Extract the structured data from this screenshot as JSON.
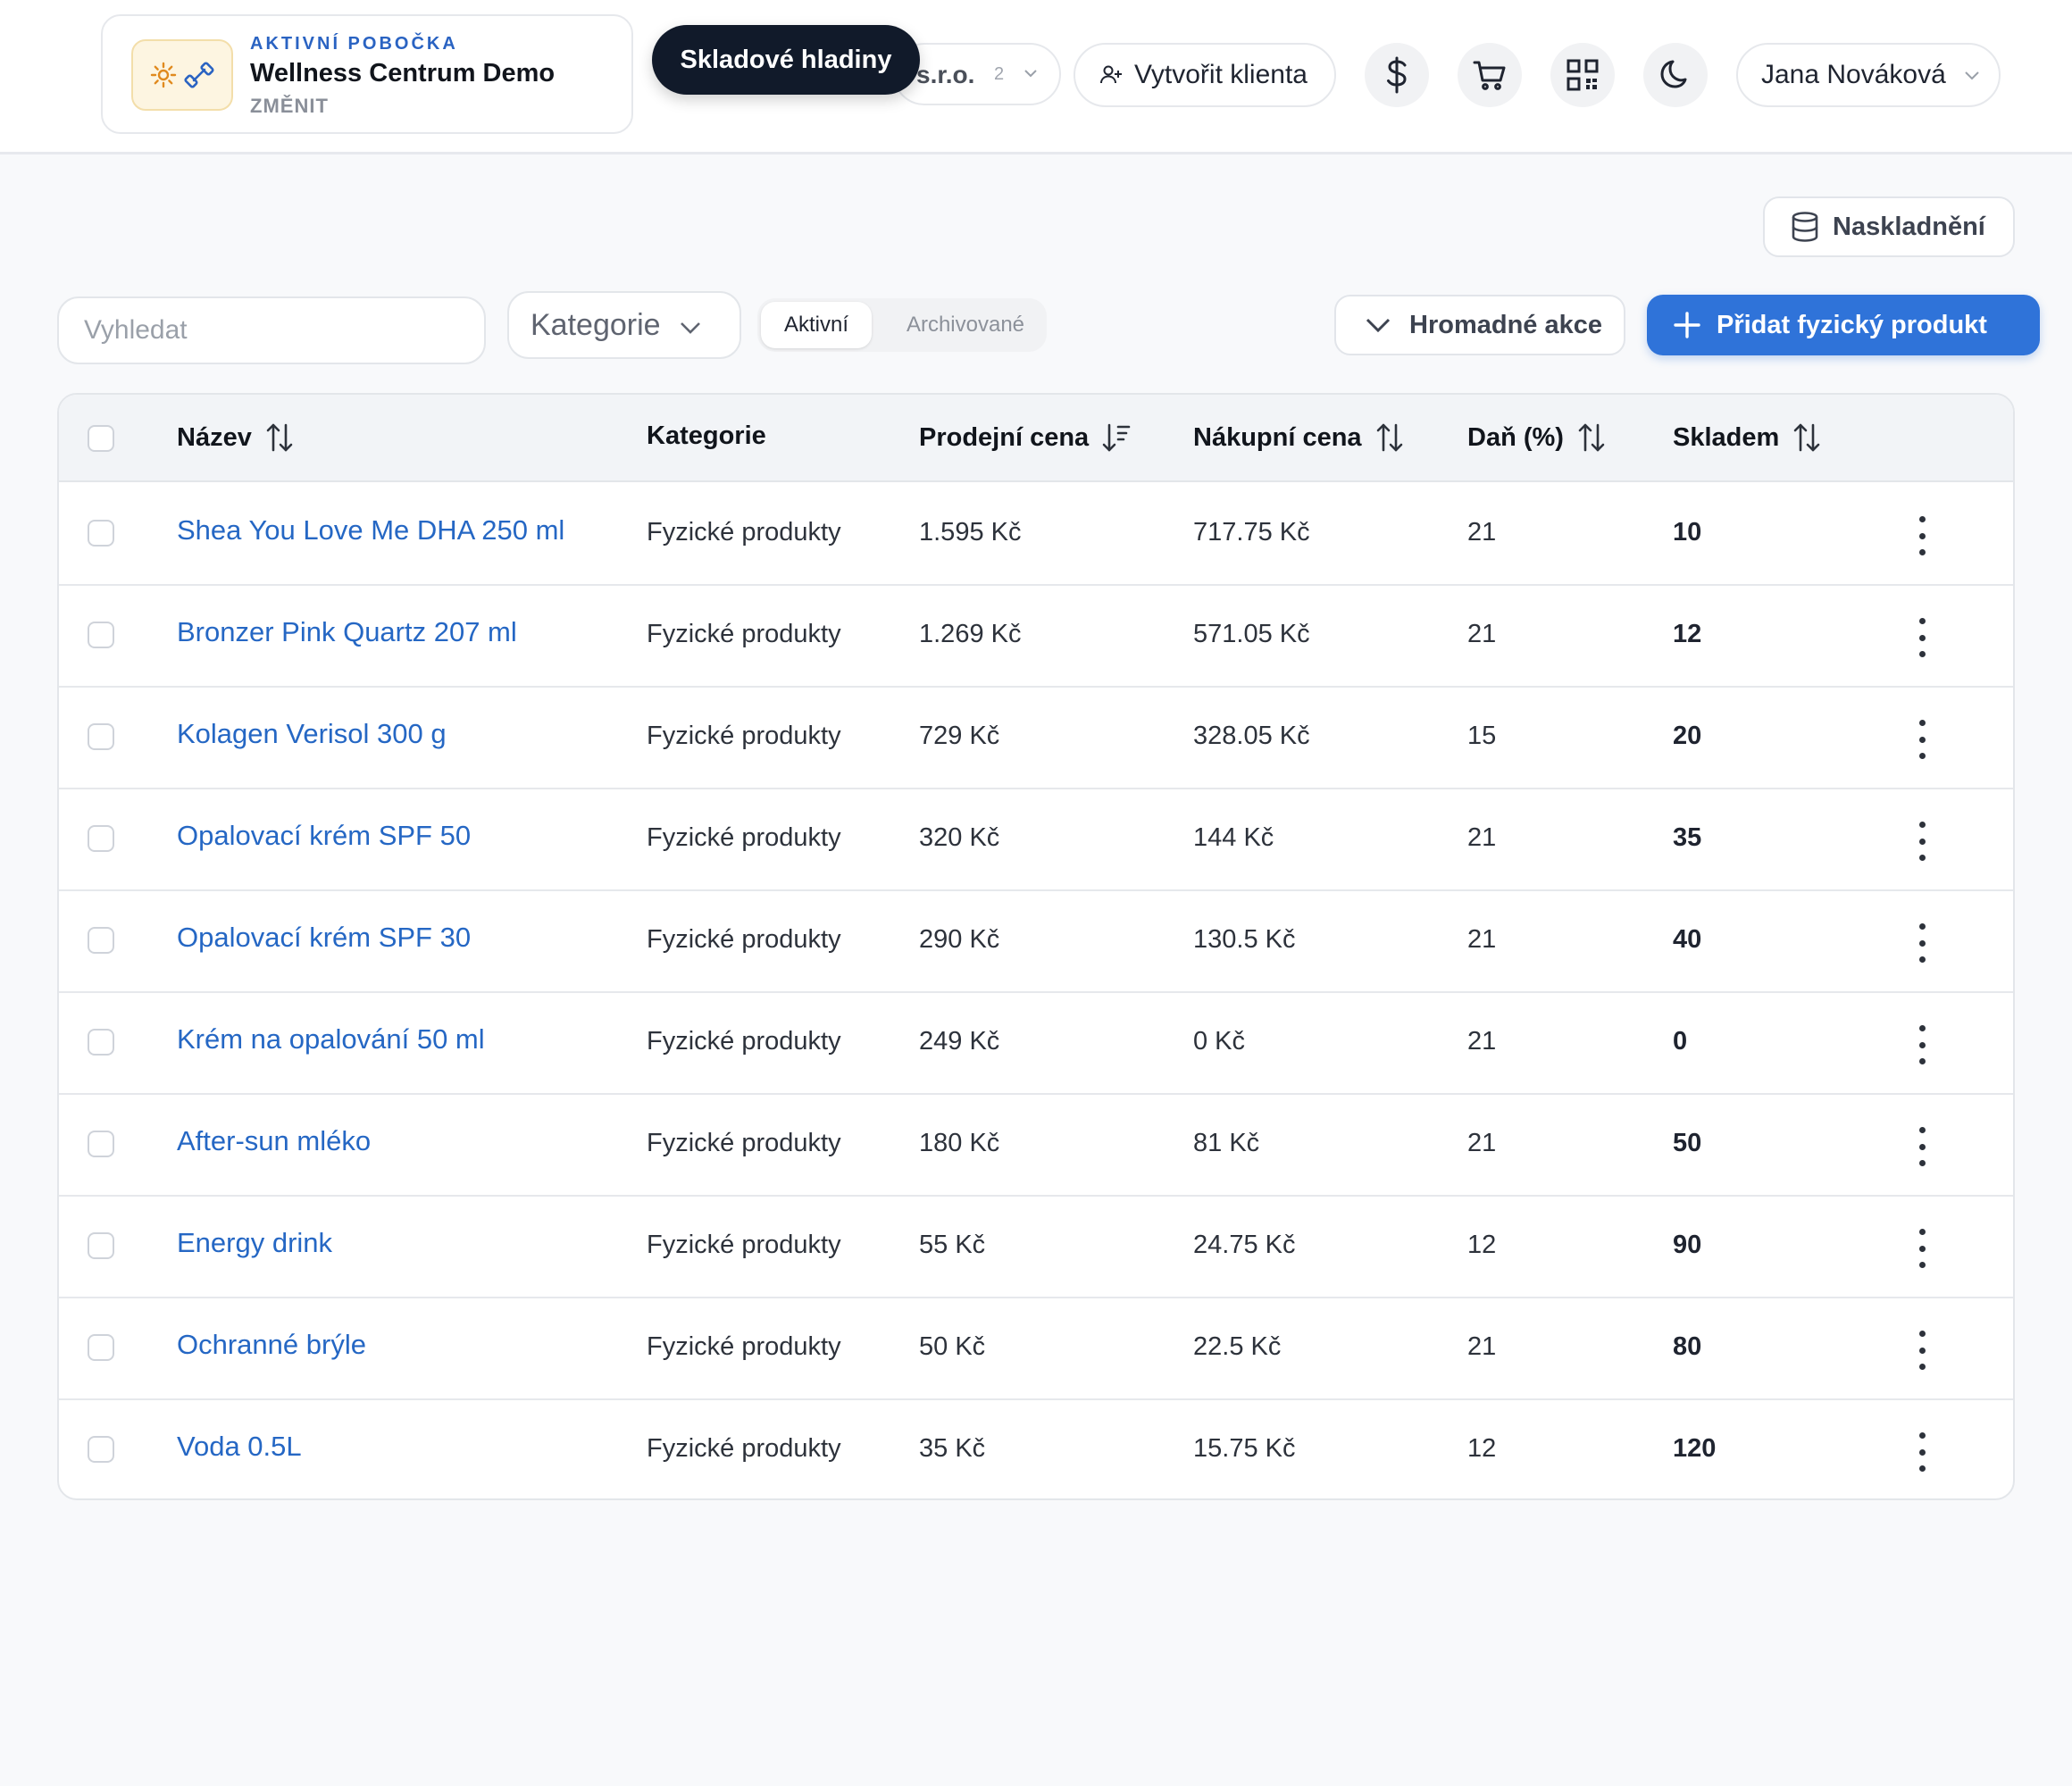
{
  "header": {
    "branch_label": "AKTIVNÍ POBOČKA",
    "branch_name": "Wellness Centrum Demo",
    "branch_change": "ZMĚNIT",
    "company_select_text": "s.r.o.",
    "company_select_badge": "2",
    "tooltip": "Skladové hladiny",
    "create_client_label": "Vytvořit klienta",
    "user_name": "Jana Nováková"
  },
  "toolbar": {
    "restock_label": "Naskladnění",
    "search_placeholder": "Vyhledat",
    "category_label": "Kategorie",
    "tab_active": "Aktivní",
    "tab_archived": "Archivované",
    "bulk_label": "Hromadné akce",
    "add_label": "Přidat fyzický produkt"
  },
  "table": {
    "columns": {
      "name": "Název",
      "category": "Kategorie",
      "sale_price": "Prodejní cena",
      "purchase_price": "Nákupní cena",
      "tax": "Daň (%)",
      "stock": "Skladem"
    },
    "rows": [
      {
        "name": "Shea You Love Me DHA 250 ml",
        "category": "Fyzické produkty",
        "sale_price": "1.595 Kč",
        "purchase_price": "717.75 Kč",
        "tax": "21",
        "stock": "10"
      },
      {
        "name": "Bronzer Pink Quartz 207 ml",
        "category": "Fyzické produkty",
        "sale_price": "1.269 Kč",
        "purchase_price": "571.05 Kč",
        "tax": "21",
        "stock": "12"
      },
      {
        "name": "Kolagen Verisol 300 g",
        "category": "Fyzické produkty",
        "sale_price": "729 Kč",
        "purchase_price": "328.05 Kč",
        "tax": "15",
        "stock": "20"
      },
      {
        "name": "Opalovací krém SPF 50",
        "category": "Fyzické produkty",
        "sale_price": "320 Kč",
        "purchase_price": "144 Kč",
        "tax": "21",
        "stock": "35"
      },
      {
        "name": "Opalovací krém SPF 30",
        "category": "Fyzické produkty",
        "sale_price": "290 Kč",
        "purchase_price": "130.5 Kč",
        "tax": "21",
        "stock": "40"
      },
      {
        "name": "Krém na opalování 50 ml",
        "category": "Fyzické produkty",
        "sale_price": "249 Kč",
        "purchase_price": "0 Kč",
        "tax": "21",
        "stock": "0"
      },
      {
        "name": "After-sun mléko",
        "category": "Fyzické produkty",
        "sale_price": "180 Kč",
        "purchase_price": "81 Kč",
        "tax": "21",
        "stock": "50"
      },
      {
        "name": "Energy drink",
        "category": "Fyzické produkty",
        "sale_price": "55 Kč",
        "purchase_price": "24.75 Kč",
        "tax": "12",
        "stock": "90"
      },
      {
        "name": "Ochranné brýle",
        "category": "Fyzické produkty",
        "sale_price": "50 Kč",
        "purchase_price": "22.5 Kč",
        "tax": "21",
        "stock": "80"
      },
      {
        "name": "Voda 0.5L",
        "category": "Fyzické produkty",
        "sale_price": "35 Kč",
        "purchase_price": "15.75 Kč",
        "tax": "12",
        "stock": "120"
      }
    ]
  },
  "icons": {
    "branch_logo": [
      "sun-icon",
      "dumbbell-icon"
    ],
    "currency": "dollar-icon",
    "cart": "cart-icon",
    "qr": "qr-code-icon",
    "theme": "moon-icon",
    "restock": "database-icon",
    "sort": "sort-icon",
    "row_menu": "kebab-menu-icon"
  },
  "colors": {
    "accent": "#2f73d9",
    "link": "#2567c4",
    "tooltip_bg": "#111a2a"
  }
}
